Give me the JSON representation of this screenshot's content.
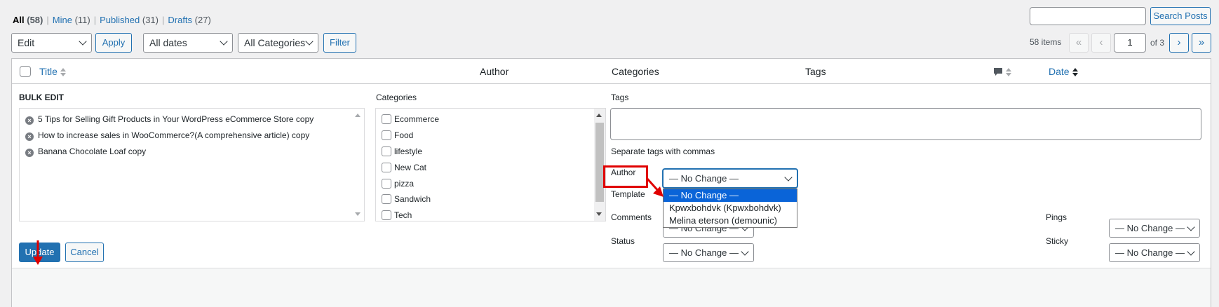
{
  "views": [
    {
      "label": "All",
      "count": "(58)",
      "current": true
    },
    {
      "label": "Mine",
      "count": "(11)",
      "current": false
    },
    {
      "label": "Published",
      "count": "(31)",
      "current": false
    },
    {
      "label": "Drafts",
      "count": "(27)",
      "current": false
    }
  ],
  "search": {
    "button": "Search Posts",
    "value": ""
  },
  "bulk_action": {
    "selected": "Edit",
    "apply": "Apply"
  },
  "filters": {
    "dates": "All dates",
    "categories": "All Categories",
    "filter_button": "Filter"
  },
  "pagination": {
    "items": "58 items",
    "first": "«",
    "prev": "‹",
    "current": "1",
    "of": "of 3",
    "next": "›",
    "last": "»"
  },
  "columns": {
    "title": "Title",
    "author": "Author",
    "categories": "Categories",
    "tags": "Tags",
    "date": "Date"
  },
  "bulk_edit": {
    "heading": "BULK EDIT",
    "titles": [
      "5 Tips for Selling Gift Products in Your WordPress eCommerce Store copy",
      "How to increase sales in WooCommerce?(A comprehensive article) copy",
      "Banana Chocolate Loaf copy"
    ],
    "categories_label": "Categories",
    "categories": [
      "Ecommerce",
      "Food",
      "lifestyle",
      "New Cat",
      "pizza",
      "Sandwich",
      "Tech"
    ],
    "tags_label": "Tags",
    "tags_hint": "Separate tags with commas",
    "author_label": "Author",
    "author_value": "— No Change —",
    "author_options": [
      "— No Change —",
      "Kpwxbohdvk (Kpwxbohdvk)",
      "Melina eterson (demounic)"
    ],
    "template_label": "Template",
    "comments_label": "Comments",
    "comments_value": "— No Change —",
    "status_label": "Status",
    "status_value": "— No Change —",
    "pings_label": "Pings",
    "pings_value": "— No Change —",
    "sticky_label": "Sticky",
    "sticky_value": "— No Change —",
    "update": "Update",
    "cancel": "Cancel"
  },
  "colors": {
    "accent": "#2271b1",
    "annotation": "#e00000",
    "selected_option": "#0a64d8"
  }
}
